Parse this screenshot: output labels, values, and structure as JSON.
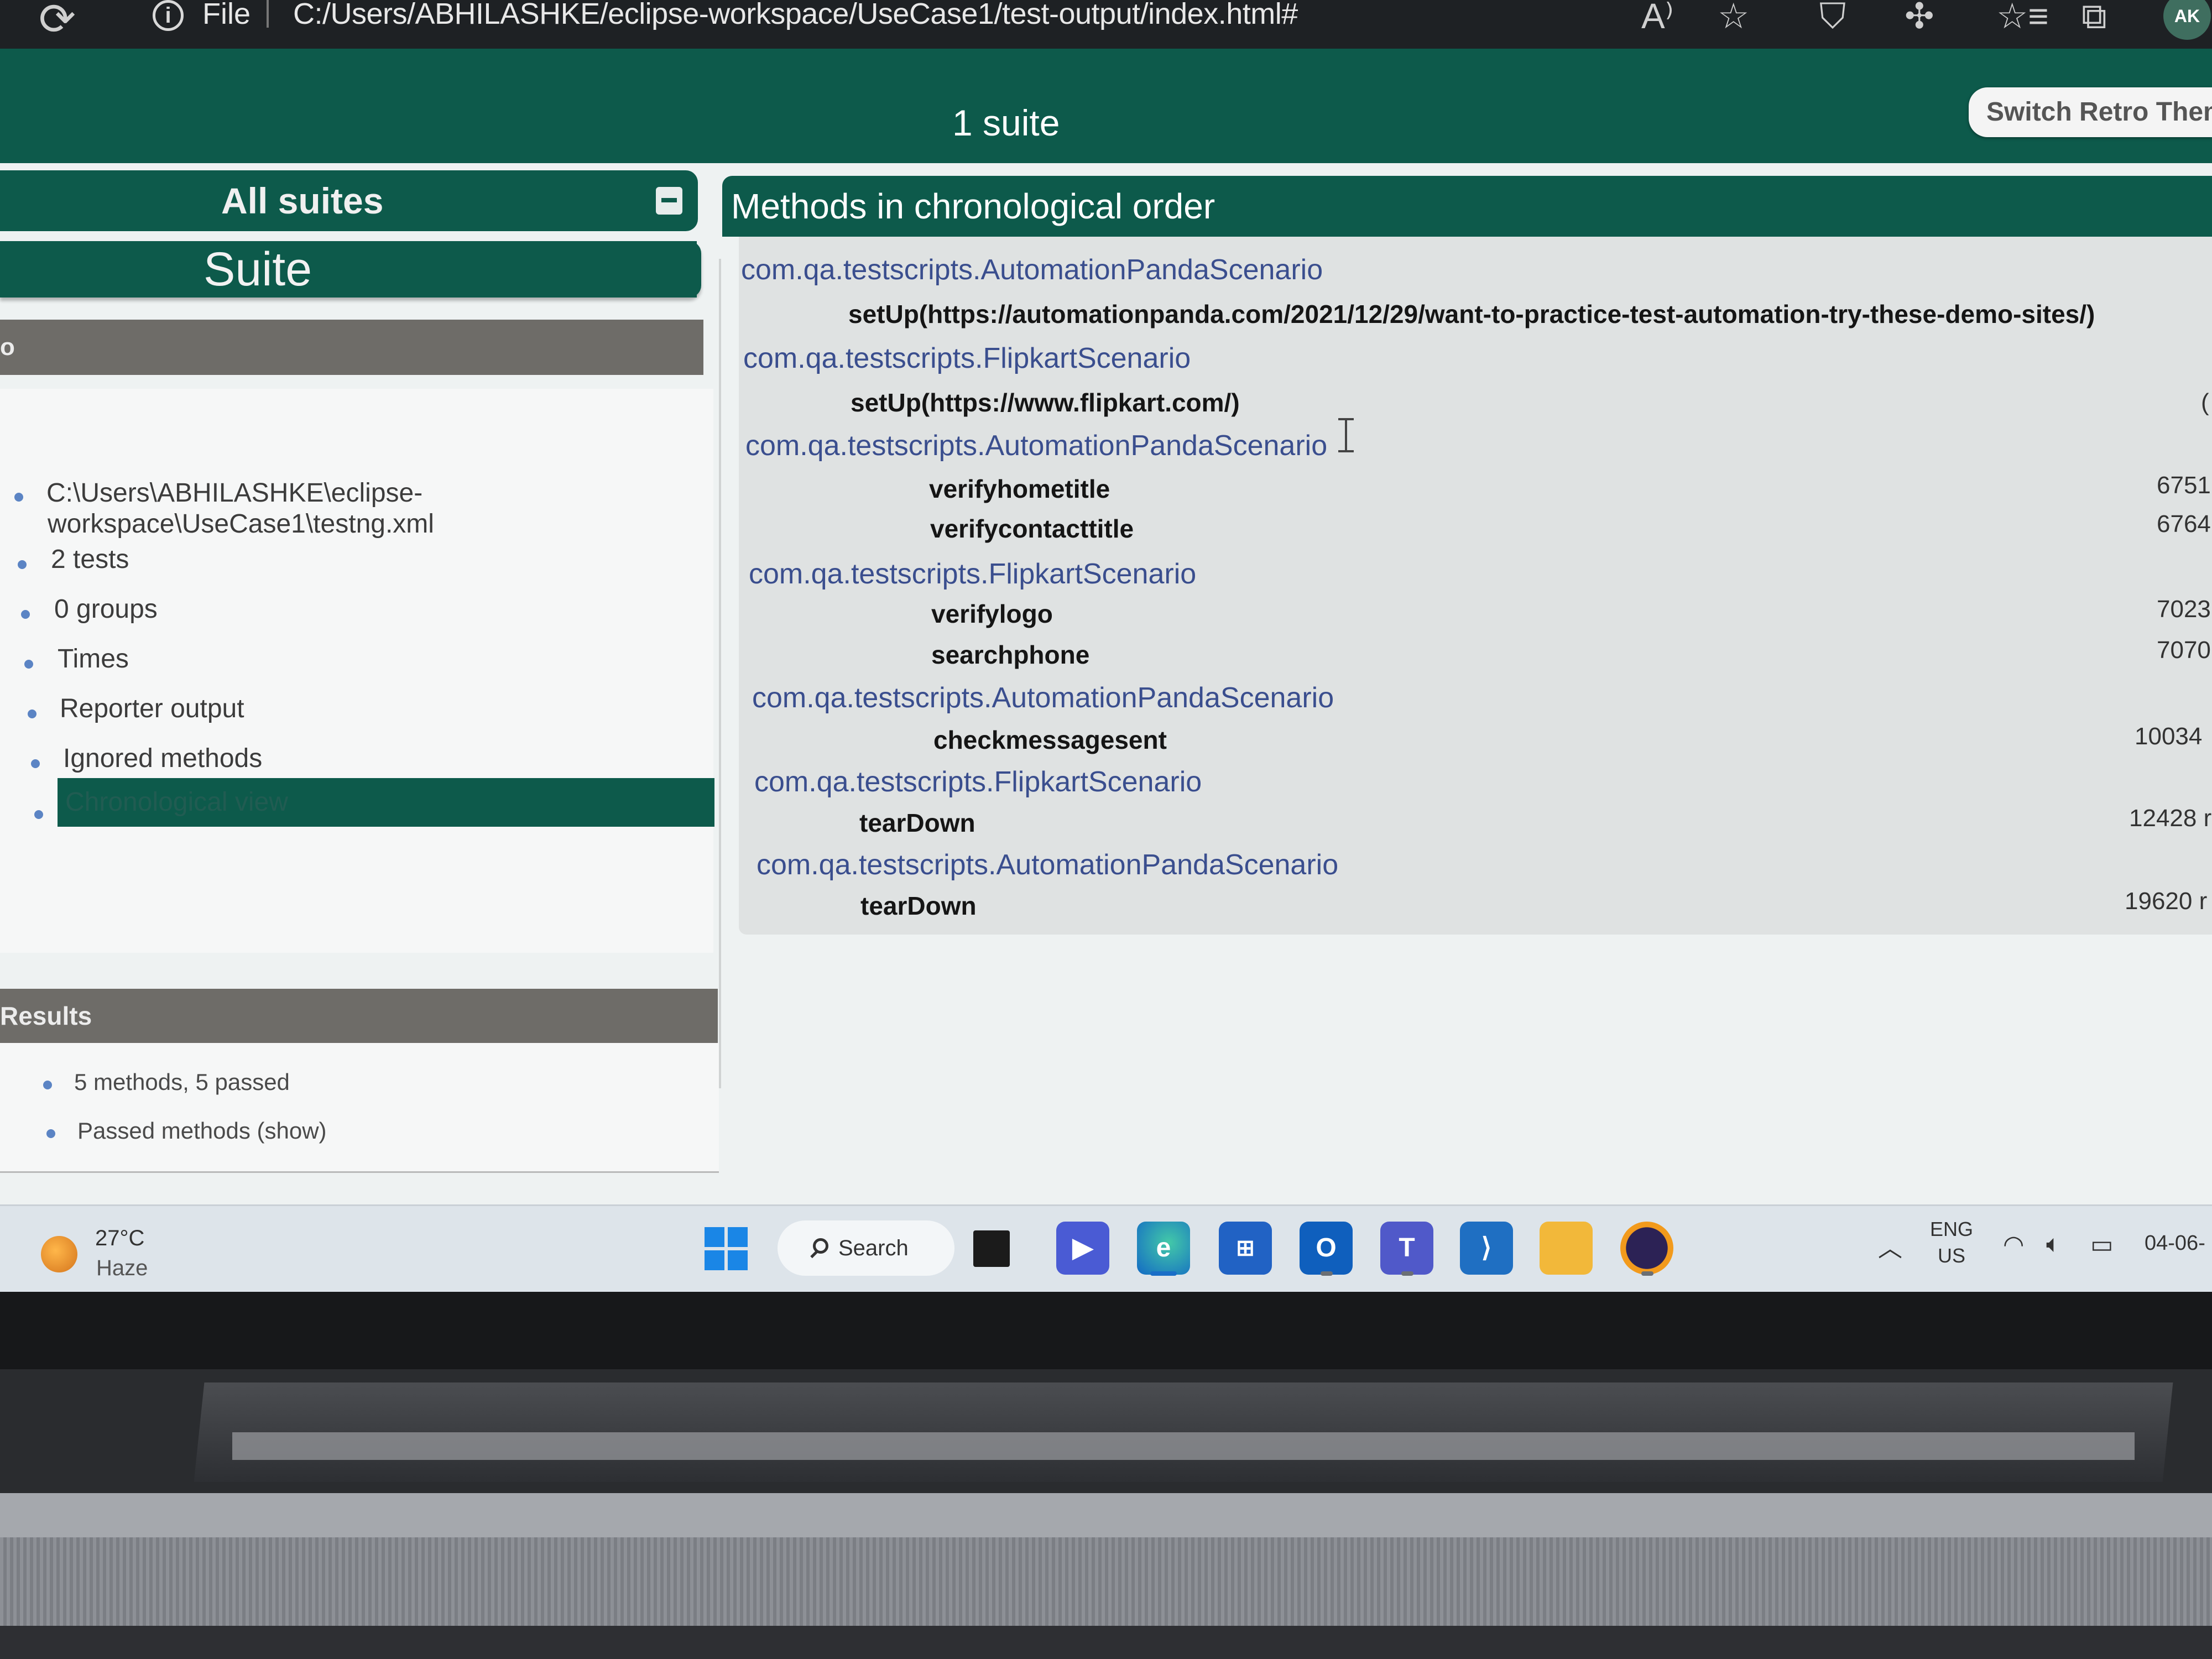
{
  "browser": {
    "file_label": "File",
    "url": "C:/Users/ABHILASHKE/eclipse-workspace/UseCase1/test-output/index.html#",
    "profile_initials": "AK"
  },
  "navbar": {
    "suite_count": "1 suite",
    "switch_theme_label": "Switch Retro Them"
  },
  "sidebar": {
    "all_suites": "All suites",
    "suite_name": "Suite",
    "info_section_title": "o",
    "info_items": [
      "C:\\Users\\ABHILASHKE\\eclipse-",
      "workspace\\UseCase1\\testng.xml",
      "2 tests",
      "0 groups",
      "Times",
      "Reporter output",
      "Ignored methods",
      "Chronological view"
    ],
    "results_title": "Results",
    "results_items": [
      "5 methods, 5 passed",
      "Passed methods (show)"
    ]
  },
  "main": {
    "title": "Methods in chronological order",
    "rows": [
      {
        "cls": "com.qa.testscripts.AutomationPandaScenario"
      },
      {
        "method": "setUp(https://automationpanda.com/2021/12/29/want-to-practice-test-automation-try-these-demo-sites/)",
        "time": ""
      },
      {
        "cls": "com.qa.testscripts.FlipkartScenario"
      },
      {
        "method": "setUp(https://www.flipkart.com/)",
        "time": "("
      },
      {
        "cls": "com.qa.testscripts.AutomationPandaScenario"
      },
      {
        "method": "verifyhometitle",
        "time": "6751"
      },
      {
        "method": "verifycontacttitle",
        "time": "6764"
      },
      {
        "cls": "com.qa.testscripts.FlipkartScenario"
      },
      {
        "method": "verifylogo",
        "time": "7023"
      },
      {
        "method": "searchphone",
        "time": "7070"
      },
      {
        "cls": "com.qa.testscripts.AutomationPandaScenario"
      },
      {
        "method": "checkmessagesent",
        "time": "10034"
      },
      {
        "cls": "com.qa.testscripts.FlipkartScenario"
      },
      {
        "method": "tearDown",
        "time": "12428 r"
      },
      {
        "cls": "com.qa.testscripts.AutomationPandaScenario"
      },
      {
        "method": "tearDown",
        "time": "19620 r"
      }
    ]
  },
  "taskbar": {
    "weather_temp": "27°C",
    "weather_cond": "Haze",
    "search_label": "Search",
    "lang_top": "ENG",
    "lang_bottom": "US",
    "date": "04-06-"
  },
  "colors": {
    "accent_green": "#0d5a4b",
    "link_blue": "#3a4e8e",
    "section_grey": "#6e6c68"
  },
  "icons": [
    "reload-icon",
    "info-icon",
    "read-aloud-icon",
    "favorite-star-icon",
    "shield-icon",
    "extensions-icon",
    "favorites-icon",
    "collections-icon",
    "windows-start-icon",
    "search-icon",
    "task-view-icon",
    "chat-icon",
    "edge-icon",
    "store-icon",
    "outlook-icon",
    "teams-icon",
    "vscode-icon",
    "file-explorer-icon",
    "eclipse-icon",
    "wifi-icon",
    "volume-icon",
    "battery-icon"
  ]
}
